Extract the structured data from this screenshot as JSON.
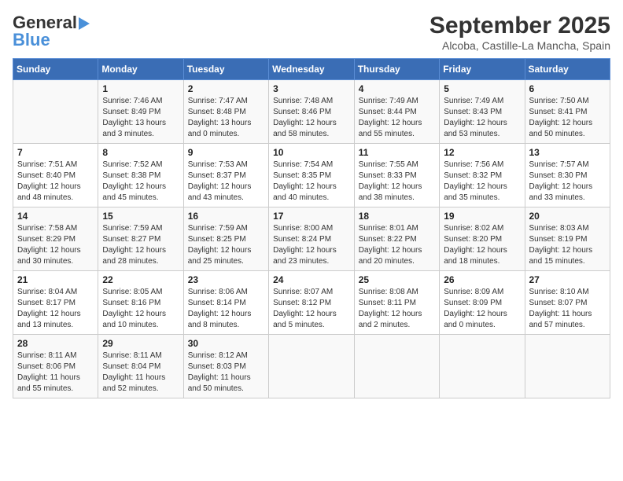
{
  "header": {
    "logo_general": "General",
    "logo_blue": "Blue",
    "title": "September 2025",
    "subtitle": "Alcoba, Castille-La Mancha, Spain"
  },
  "days_of_week": [
    "Sunday",
    "Monday",
    "Tuesday",
    "Wednesday",
    "Thursday",
    "Friday",
    "Saturday"
  ],
  "weeks": [
    [
      {
        "day": "",
        "info": ""
      },
      {
        "day": "1",
        "info": "Sunrise: 7:46 AM\nSunset: 8:49 PM\nDaylight: 13 hours\nand 3 minutes."
      },
      {
        "day": "2",
        "info": "Sunrise: 7:47 AM\nSunset: 8:48 PM\nDaylight: 13 hours\nand 0 minutes."
      },
      {
        "day": "3",
        "info": "Sunrise: 7:48 AM\nSunset: 8:46 PM\nDaylight: 12 hours\nand 58 minutes."
      },
      {
        "day": "4",
        "info": "Sunrise: 7:49 AM\nSunset: 8:44 PM\nDaylight: 12 hours\nand 55 minutes."
      },
      {
        "day": "5",
        "info": "Sunrise: 7:49 AM\nSunset: 8:43 PM\nDaylight: 12 hours\nand 53 minutes."
      },
      {
        "day": "6",
        "info": "Sunrise: 7:50 AM\nSunset: 8:41 PM\nDaylight: 12 hours\nand 50 minutes."
      }
    ],
    [
      {
        "day": "7",
        "info": "Sunrise: 7:51 AM\nSunset: 8:40 PM\nDaylight: 12 hours\nand 48 minutes."
      },
      {
        "day": "8",
        "info": "Sunrise: 7:52 AM\nSunset: 8:38 PM\nDaylight: 12 hours\nand 45 minutes."
      },
      {
        "day": "9",
        "info": "Sunrise: 7:53 AM\nSunset: 8:37 PM\nDaylight: 12 hours\nand 43 minutes."
      },
      {
        "day": "10",
        "info": "Sunrise: 7:54 AM\nSunset: 8:35 PM\nDaylight: 12 hours\nand 40 minutes."
      },
      {
        "day": "11",
        "info": "Sunrise: 7:55 AM\nSunset: 8:33 PM\nDaylight: 12 hours\nand 38 minutes."
      },
      {
        "day": "12",
        "info": "Sunrise: 7:56 AM\nSunset: 8:32 PM\nDaylight: 12 hours\nand 35 minutes."
      },
      {
        "day": "13",
        "info": "Sunrise: 7:57 AM\nSunset: 8:30 PM\nDaylight: 12 hours\nand 33 minutes."
      }
    ],
    [
      {
        "day": "14",
        "info": "Sunrise: 7:58 AM\nSunset: 8:29 PM\nDaylight: 12 hours\nand 30 minutes."
      },
      {
        "day": "15",
        "info": "Sunrise: 7:59 AM\nSunset: 8:27 PM\nDaylight: 12 hours\nand 28 minutes."
      },
      {
        "day": "16",
        "info": "Sunrise: 7:59 AM\nSunset: 8:25 PM\nDaylight: 12 hours\nand 25 minutes."
      },
      {
        "day": "17",
        "info": "Sunrise: 8:00 AM\nSunset: 8:24 PM\nDaylight: 12 hours\nand 23 minutes."
      },
      {
        "day": "18",
        "info": "Sunrise: 8:01 AM\nSunset: 8:22 PM\nDaylight: 12 hours\nand 20 minutes."
      },
      {
        "day": "19",
        "info": "Sunrise: 8:02 AM\nSunset: 8:20 PM\nDaylight: 12 hours\nand 18 minutes."
      },
      {
        "day": "20",
        "info": "Sunrise: 8:03 AM\nSunset: 8:19 PM\nDaylight: 12 hours\nand 15 minutes."
      }
    ],
    [
      {
        "day": "21",
        "info": "Sunrise: 8:04 AM\nSunset: 8:17 PM\nDaylight: 12 hours\nand 13 minutes."
      },
      {
        "day": "22",
        "info": "Sunrise: 8:05 AM\nSunset: 8:16 PM\nDaylight: 12 hours\nand 10 minutes."
      },
      {
        "day": "23",
        "info": "Sunrise: 8:06 AM\nSunset: 8:14 PM\nDaylight: 12 hours\nand 8 minutes."
      },
      {
        "day": "24",
        "info": "Sunrise: 8:07 AM\nSunset: 8:12 PM\nDaylight: 12 hours\nand 5 minutes."
      },
      {
        "day": "25",
        "info": "Sunrise: 8:08 AM\nSunset: 8:11 PM\nDaylight: 12 hours\nand 2 minutes."
      },
      {
        "day": "26",
        "info": "Sunrise: 8:09 AM\nSunset: 8:09 PM\nDaylight: 12 hours\nand 0 minutes."
      },
      {
        "day": "27",
        "info": "Sunrise: 8:10 AM\nSunset: 8:07 PM\nDaylight: 11 hours\nand 57 minutes."
      }
    ],
    [
      {
        "day": "28",
        "info": "Sunrise: 8:11 AM\nSunset: 8:06 PM\nDaylight: 11 hours\nand 55 minutes."
      },
      {
        "day": "29",
        "info": "Sunrise: 8:11 AM\nSunset: 8:04 PM\nDaylight: 11 hours\nand 52 minutes."
      },
      {
        "day": "30",
        "info": "Sunrise: 8:12 AM\nSunset: 8:03 PM\nDaylight: 11 hours\nand 50 minutes."
      },
      {
        "day": "",
        "info": ""
      },
      {
        "day": "",
        "info": ""
      },
      {
        "day": "",
        "info": ""
      },
      {
        "day": "",
        "info": ""
      }
    ]
  ]
}
